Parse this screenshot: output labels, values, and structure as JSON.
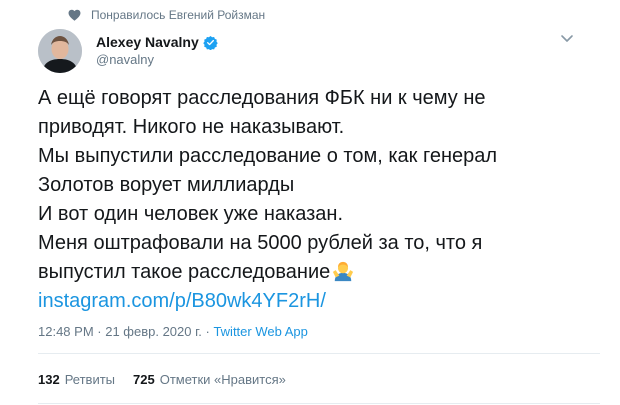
{
  "social_context": {
    "icon": "heart-icon",
    "text": "Понравилось Евгений Ройзман"
  },
  "author": {
    "name": "Alexey Navalny",
    "handle": "@navalny",
    "verified_icon": "verified-badge-icon"
  },
  "tweet": {
    "lines": [
      "А ещё говорят расследования ФБК ни к чему не",
      "приводят. Никого не наказывают.",
      "Мы выпустили расследование о том, как генерал",
      "Золотов ворует миллиарды",
      "И вот один человек уже наказан.",
      "Меня оштрафовали на 5000 рублей за то, что я",
      "выпустил такое расследование"
    ],
    "emoji": "man-shrugging-emoji",
    "link": "instagram.com/p/B80wk4YF2rH/"
  },
  "meta": {
    "time": "12:48 PM",
    "dot": " · ",
    "date": "21 февр. 2020 г.",
    "app": "Twitter Web App"
  },
  "stats": {
    "retweets_count": "132",
    "retweets_label": "Ретвиты",
    "likes_count": "725",
    "likes_label": "Отметки «Нравится»"
  },
  "colors": {
    "link": "#1b95e0",
    "secondary": "#657786",
    "text": "#14171a",
    "divider": "#e6ecf0"
  }
}
